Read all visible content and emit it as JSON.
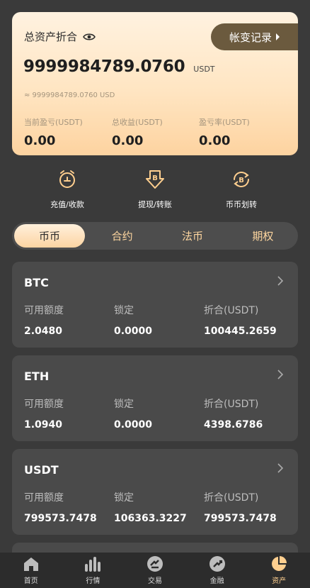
{
  "summary": {
    "title": "总资产折合",
    "record_button": "帐变记录",
    "total": "9999984789.0760",
    "total_unit": "USDT",
    "approx": "≈ 9999984789.0760 USD",
    "stats": [
      {
        "label": "当前盈亏(USDT)",
        "value": "0.00"
      },
      {
        "label": "总收益(USDT)",
        "value": "0.00"
      },
      {
        "label": "盈亏率(USDT)",
        "value": "0.00"
      }
    ]
  },
  "actions": [
    {
      "label": "充值/收款",
      "icon": "deposit-clock-icon"
    },
    {
      "label": "提现/转账",
      "icon": "withdraw-bitcoin-icon"
    },
    {
      "label": "币币划转",
      "icon": "transfer-bitcoin-icon"
    }
  ],
  "tabs": [
    {
      "label": "币币",
      "active": true
    },
    {
      "label": "合约"
    },
    {
      "label": "法币"
    },
    {
      "label": "期权"
    }
  ],
  "assets": [
    {
      "coin": "BTC",
      "labels": [
        "可用额度",
        "锁定",
        "折合(USDT)"
      ],
      "values": [
        "2.0480",
        "0.0000",
        "100445.2659"
      ]
    },
    {
      "coin": "ETH",
      "labels": [
        "可用额度",
        "锁定",
        "折合(USDT)"
      ],
      "values": [
        "1.0940",
        "0.0000",
        "4398.6786"
      ]
    },
    {
      "coin": "USDT",
      "labels": [
        "可用额度",
        "锁定",
        "折合(USDT)"
      ],
      "values": [
        "799573.7478",
        "106363.3227",
        "799573.7478"
      ]
    }
  ],
  "nav": [
    {
      "label": "首页",
      "icon": "home-icon"
    },
    {
      "label": "行情",
      "icon": "market-bars-icon"
    },
    {
      "label": "交易",
      "icon": "trade-icon"
    },
    {
      "label": "金融",
      "icon": "finance-icon"
    },
    {
      "label": "资产",
      "icon": "assets-pie-icon",
      "active": true
    }
  ],
  "colors": {
    "background": "#3a3a3a",
    "card": "#4a4a4a",
    "accent": "#ffcf8f",
    "record_button": "#6b5a3e"
  }
}
